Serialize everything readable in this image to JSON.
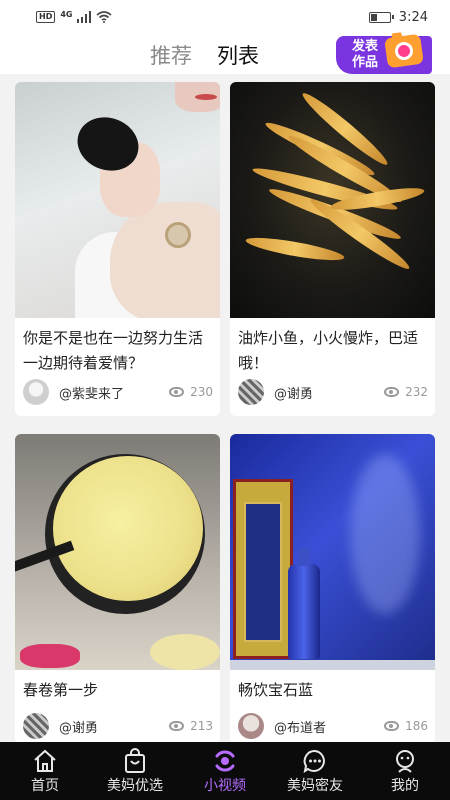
{
  "status_bar": {
    "network": "4G",
    "hd": "HD",
    "time": "3:24"
  },
  "top_tabs": {
    "recommend": "推荐",
    "list": "列表",
    "active": "list"
  },
  "publish_button": {
    "line1": "发表",
    "line2": "作品"
  },
  "cards": [
    {
      "title": "你是不是也在一边努力生活一边期待着爱情？",
      "author": "@紫斐来了",
      "views": "230"
    },
    {
      "title": "油炸小鱼，小火慢炸，巴适哦！",
      "author": "@谢勇",
      "views": "232"
    },
    {
      "title": "春卷第一步",
      "author": "@谢勇",
      "views": "213"
    },
    {
      "title": "畅饮宝石蓝",
      "author": "@布道者",
      "views": "186"
    }
  ],
  "bottom_nav": [
    {
      "label": "首页",
      "icon": "home-icon"
    },
    {
      "label": "美妈优选",
      "icon": "shopping-bag-icon"
    },
    {
      "label": "小视频",
      "icon": "video-icon",
      "active": true
    },
    {
      "label": "美妈密友",
      "icon": "chat-bubble-icon"
    },
    {
      "label": "我的",
      "icon": "profile-icon"
    }
  ],
  "colors": {
    "accent_purple": "#7b35e0",
    "active_nav": "#b76cff",
    "nav_bg": "#0b0b0b",
    "page_bg": "#f2f2f2"
  }
}
